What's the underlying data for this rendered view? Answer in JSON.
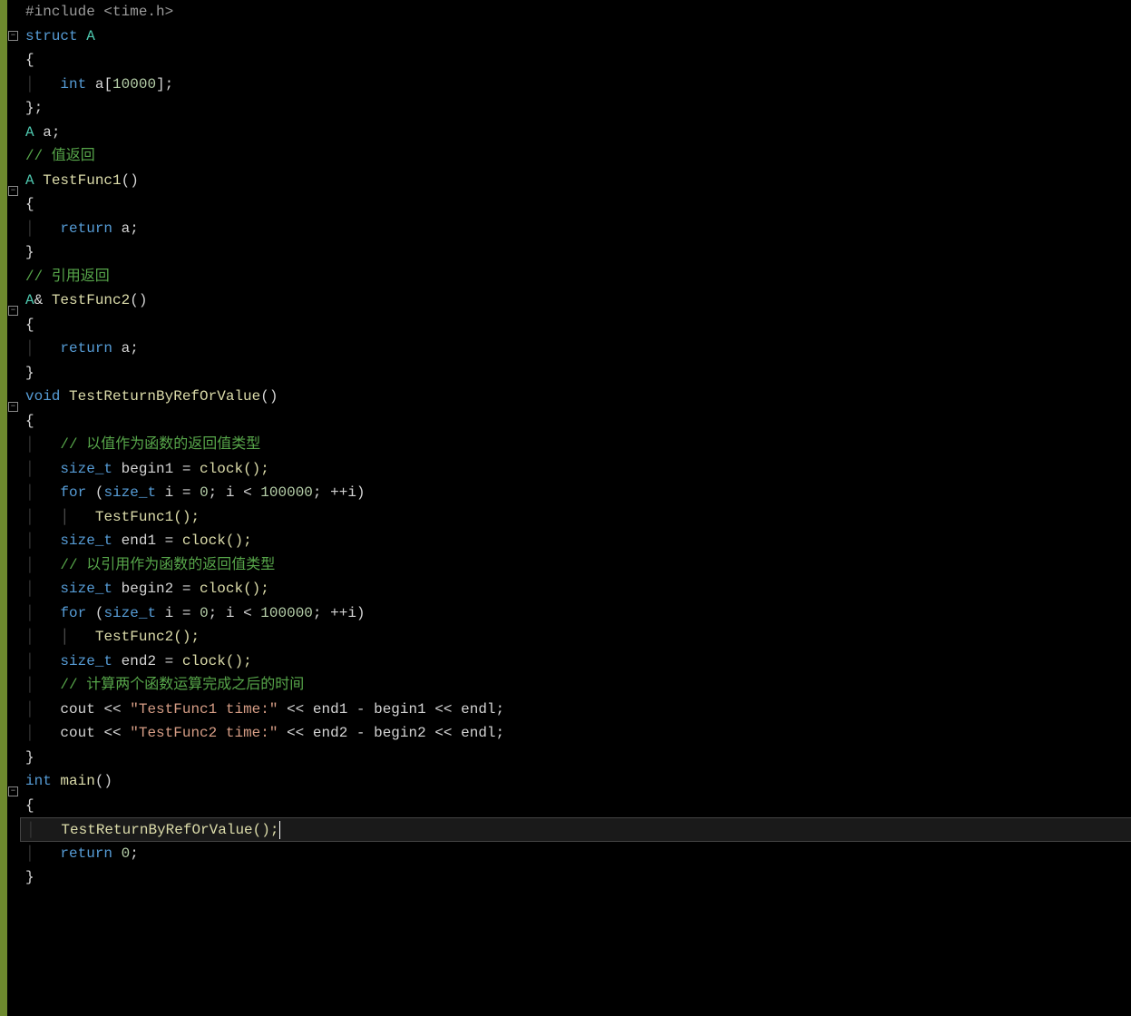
{
  "code": {
    "include": "#include <time.h>",
    "struct_decl": "struct A",
    "open_brace": "{",
    "array_decl_indent": "    ",
    "array_type": "int",
    "array_name": " a",
    "array_bracket_open": "[",
    "array_size": "10000",
    "array_bracket_close": "];",
    "close_brace_semi": "};",
    "global_a_type": "A",
    "global_a_name": " a;",
    "comment_val_return": "// 值返回",
    "func1_type": "A",
    "func1_name": " TestFunc1",
    "func1_parens": "()",
    "return_kw": "return",
    "return_a": " a;",
    "close_brace": "}",
    "comment_ref_return": "// 引用返回",
    "func2_type": "A",
    "func2_ref": "&",
    "func2_name": " TestFunc2",
    "func2_parens": "()",
    "void_kw": "void",
    "testfn_name": " TestReturnByRefOrValue",
    "testfn_parens": "()",
    "comment_val_type": "// 以值作为函数的返回值类型",
    "sizet": "size_t",
    "begin1_name": " begin1 ",
    "eq": "=",
    "clock_call": " clock();",
    "for_kw": "for",
    "for_open": " (",
    "i_decl": " i ",
    "zero": " 0",
    "semi_sp": "; ",
    "i_var": "i ",
    "lt": "<",
    "loop_count": " 100000",
    "plusplus": " ++",
    "i_close": "i)",
    "call_func1": "TestFunc1();",
    "end1_name": " end1 ",
    "comment_ref_type": "// 以引用作为函数的返回值类型",
    "begin2_name": " begin2 ",
    "call_func2": "TestFunc2();",
    "end2_name": " end2 ",
    "comment_time": "// 计算两个函数运算完成之后的时间",
    "cout_kw": "cout ",
    "stream_op": "<<",
    "str_time1": " \"TestFunc1 time:\" ",
    "str_time2": " \"TestFunc2 time:\" ",
    "end1_var": " end1 ",
    "begin1_var": " begin1 ",
    "end2_var": " end2 ",
    "begin2_var": " begin2 ",
    "minus": "-",
    "endl": " endl;",
    "int_kw": "int",
    "main_name": " main",
    "main_parens": "()",
    "call_test": "TestReturnByRefOrValue();",
    "return_zero_kw": "return",
    "return_zero_val": " 0",
    "return_zero_semi": ";"
  },
  "fold": {
    "minus": "−"
  }
}
